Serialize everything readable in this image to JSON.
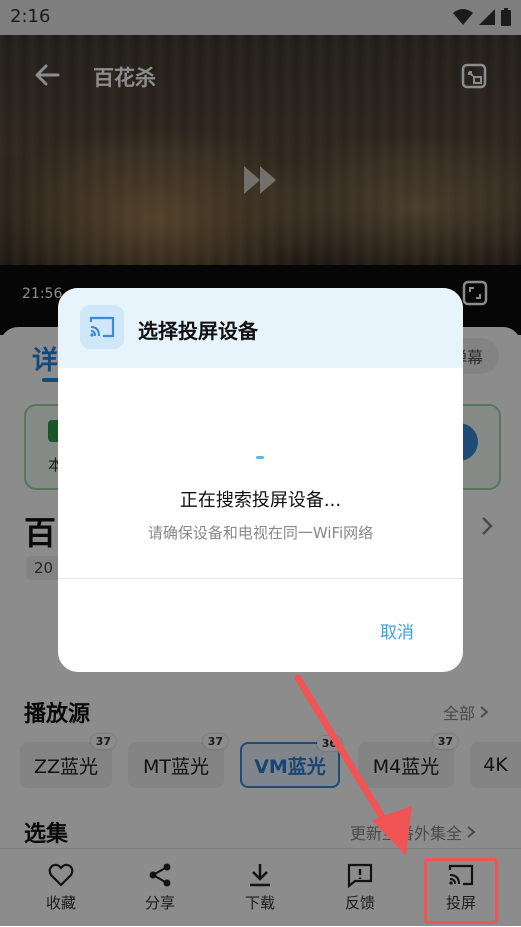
{
  "status_bar": {
    "time": "2:16"
  },
  "video": {
    "title": "百花杀",
    "current_time": "21:56"
  },
  "detail": {
    "tab_label": "详",
    "danmu_label": "弹幕",
    "card_text": "本",
    "title_fragment": "百",
    "year_fragment": "20"
  },
  "sources": {
    "title": "播放源",
    "more": "全部",
    "items": [
      {
        "label": "ZZ蓝光",
        "badge": "37"
      },
      {
        "label": "MT蓝光",
        "badge": "37"
      },
      {
        "label": "VM蓝光",
        "badge": "36"
      },
      {
        "label": "M4蓝光",
        "badge": "37"
      },
      {
        "label": "4K",
        "badge": ""
      }
    ]
  },
  "episodes": {
    "title": "选集",
    "more": "更新至番外集全"
  },
  "toolbar": {
    "favorite": "收藏",
    "share": "分享",
    "download": "下载",
    "feedback": "反馈",
    "cast": "投屏"
  },
  "dialog": {
    "title": "选择投屏设备",
    "searching": "正在搜索投屏设备...",
    "hint": "请确保设备和电视在同一WiFi网络",
    "cancel": "取消"
  },
  "colors": {
    "accent": "#3aa2e0",
    "highlight": "#f05454"
  }
}
